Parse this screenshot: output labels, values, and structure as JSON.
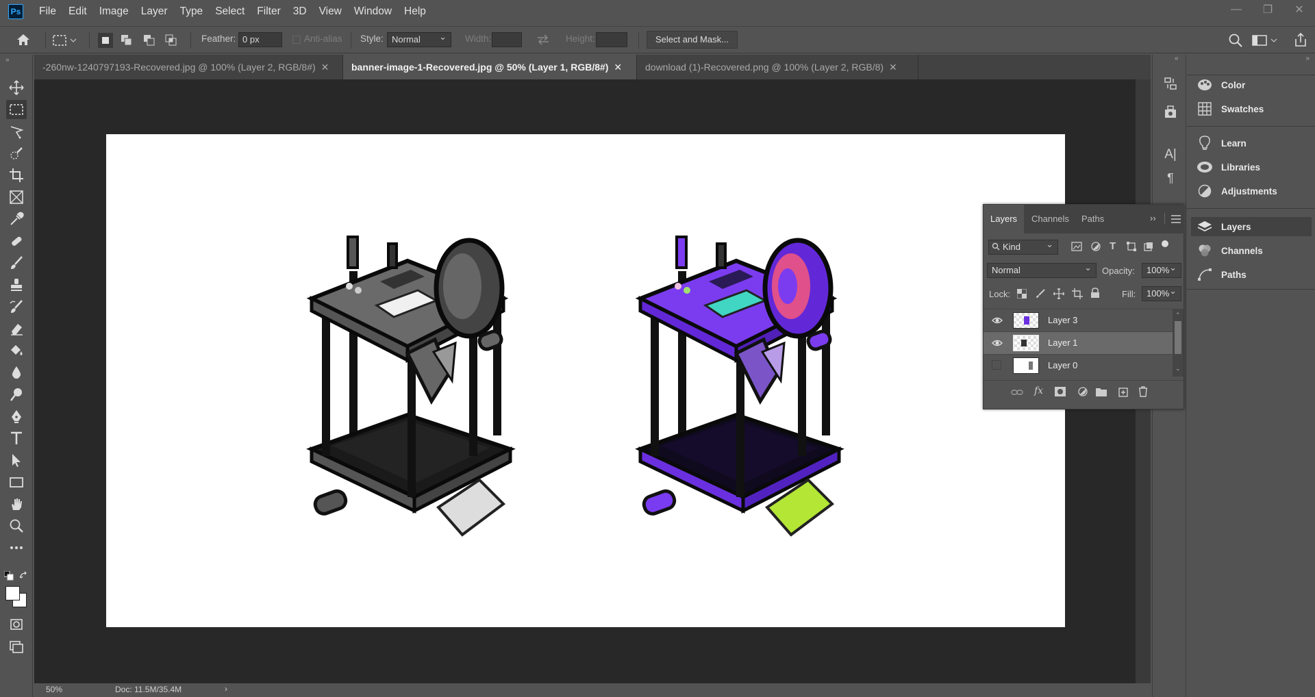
{
  "app": {
    "logo": "Ps"
  },
  "menu": [
    "File",
    "Edit",
    "Image",
    "Layer",
    "Type",
    "Select",
    "Filter",
    "3D",
    "View",
    "Window",
    "Help"
  ],
  "window_controls": {
    "minimize": "—",
    "restore": "❐",
    "close": "✕"
  },
  "options": {
    "feather_label": "Feather:",
    "feather_value": "0 px",
    "antialias_label": "Anti-alias",
    "style_label": "Style:",
    "style_value": "Normal",
    "width_label": "Width:",
    "height_label": "Height:",
    "select_mask_label": "Select and Mask..."
  },
  "tabs": [
    {
      "label": "-260nw-1240797193-Recovered.jpg @ 100% (Layer 2, RGB/8#)",
      "close": "✕",
      "active": false
    },
    {
      "label": "banner-image-1-Recovered.jpg @ 50% (Layer 1, RGB/8#)",
      "close": "✕",
      "active": true
    },
    {
      "label": "download (1)-Recovered.png @ 100% (Layer 2, RGB/8)",
      "close": "✕",
      "active": false
    }
  ],
  "status": {
    "zoom": "50%",
    "doc": "Doc: 11.5M/35.4M",
    "arrow": "›"
  },
  "right_panels": [
    {
      "label": "Color",
      "icon": "palette-icon"
    },
    {
      "label": "Swatches",
      "icon": "grid-icon"
    },
    {
      "label": "Learn",
      "icon": "lightbulb-icon"
    },
    {
      "label": "Libraries",
      "icon": "libraries-icon"
    },
    {
      "label": "Adjustments",
      "icon": "half-circle-icon"
    },
    {
      "label": "Layers",
      "icon": "layers-icon"
    },
    {
      "label": "Channels",
      "icon": "channels-icon"
    },
    {
      "label": "Paths",
      "icon": "paths-icon"
    }
  ],
  "layers_panel": {
    "tabs": [
      "Layers",
      "Channels",
      "Paths"
    ],
    "filter_kind": "Kind",
    "blend_mode": "Normal",
    "opacity_label": "Opacity:",
    "opacity_value": "100%",
    "lock_label": "Lock:",
    "fill_label": "Fill:",
    "fill_value": "100%",
    "layers": [
      {
        "name": "Layer 3",
        "visible": true,
        "selected": false
      },
      {
        "name": "Layer 1",
        "visible": true,
        "selected": true
      },
      {
        "name": "Layer 0",
        "visible": false,
        "selected": false
      }
    ]
  },
  "colors": {
    "ui_bg": "#535353",
    "canvas_bg": "#282828",
    "accent_purple": "#7b3cf0",
    "accent_teal": "#41d6c3",
    "accent_lime": "#b4e636"
  }
}
